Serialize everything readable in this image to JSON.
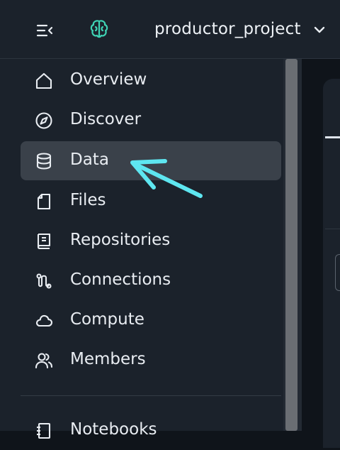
{
  "header": {
    "menu_icon": "sidebar-collapse-icon",
    "brand_icon": "brain-icon",
    "project_name": "productor_project",
    "chevron_icon": "chevron-down-icon"
  },
  "sidebar": {
    "items": [
      {
        "label": "Overview",
        "icon": "home-icon",
        "active": false
      },
      {
        "label": "Discover",
        "icon": "compass-icon",
        "active": false
      },
      {
        "label": "Data",
        "icon": "database-icon",
        "active": true
      },
      {
        "label": "Files",
        "icon": "file-icon",
        "active": false
      },
      {
        "label": "Repositories",
        "icon": "book-icon",
        "active": false
      },
      {
        "label": "Connections",
        "icon": "connections-icon",
        "active": false
      },
      {
        "label": "Compute",
        "icon": "cloud-icon",
        "active": false
      },
      {
        "label": "Members",
        "icon": "users-icon",
        "active": false
      },
      {
        "label": "Notebooks",
        "icon": "notebook-icon",
        "active": false
      }
    ]
  },
  "colors": {
    "accent": "#5ee6f0",
    "brand": "#3fd3b4",
    "background": "#1b222b",
    "active_item": "#3a414a"
  }
}
